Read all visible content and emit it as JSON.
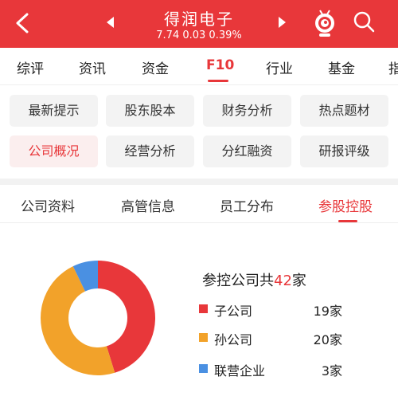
{
  "header": {
    "title": "得润电子",
    "quote": "7.74 0.03 0.39%",
    "color": "#e8373a"
  },
  "main_tabs": [
    "综评",
    "资讯",
    "资金",
    "F10",
    "行业",
    "基金",
    "指"
  ],
  "main_active": "F10",
  "chips": [
    {
      "label": "最新提示"
    },
    {
      "label": "股东股本"
    },
    {
      "label": "财务分析"
    },
    {
      "label": "热点题材"
    },
    {
      "label": "公司概况"
    },
    {
      "label": "经营分析"
    },
    {
      "label": "分红融资"
    },
    {
      "label": "研报评级"
    }
  ],
  "chips_active": "公司概况",
  "sub_tabs": [
    "公司资料",
    "高管信息",
    "员工分布",
    "参股控股"
  ],
  "sub_active": "参股控股",
  "summary": {
    "prefix": "参控公司共",
    "count": "42",
    "suffix": "家"
  },
  "chart_data": {
    "type": "pie",
    "title": "",
    "categories": [
      "子公司",
      "孙公司",
      "联营企业"
    ],
    "values": [
      19,
      20,
      3
    ],
    "value_labels": [
      "19家",
      "20家",
      "3家"
    ],
    "colors": [
      "#e8373a",
      "#f2a22a",
      "#4a90e2"
    ],
    "style": "donut"
  }
}
